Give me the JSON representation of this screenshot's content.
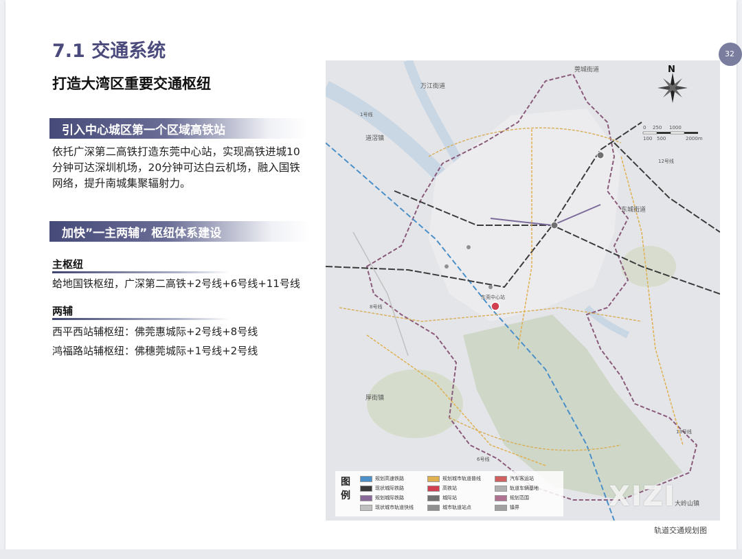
{
  "section_title": "7.1 交通系统",
  "subtitle": "打造大湾区重要交通枢纽",
  "band1": "引入中心城区第一个区域高铁站",
  "paragraph": "依托广深第二高铁打造东莞中心站，实现高铁进城10分钟可达深圳机场，20分钟可达白云机场，融入国铁网络，提升南城集聚辐射力。",
  "band2": "加快”一主两辅” 枢纽体系建设",
  "main_hub": {
    "heading": "主枢纽",
    "text": "蛤地国铁枢纽，广深第二高铁+2号线+6号线+11号线"
  },
  "aux_hubs": {
    "heading": "两辅",
    "items": [
      "西平西站辅枢纽：佛莞惠城际+2号线+8号线",
      "鸿福路站辅枢纽：佛穗莞城际+1号线+2号线"
    ]
  },
  "page_number": "32",
  "map": {
    "caption": "轨道交通规划图",
    "place_labels": [
      "莞城街道",
      "万江街道",
      "道滘镇",
      "东城街道",
      "厚街镇",
      "大岭山镇",
      "东莞中心站"
    ],
    "line_labels": [
      "1号线",
      "12号线",
      "6号线",
      "8号线",
      "13号线"
    ],
    "scale_labels": [
      "0",
      "250",
      "1000",
      "100",
      "500",
      "2000m"
    ],
    "north": "N",
    "legend_title": "图例",
    "legend": [
      {
        "label": "规划高速铁路",
        "color": "#4a8fc8"
      },
      {
        "label": "现状城际铁路",
        "color": "#3a3a3a"
      },
      {
        "label": "规划城际铁路",
        "color": "#8a6a9a"
      },
      {
        "label": "现状城市轨道快线",
        "color": "#c0c0c0"
      },
      {
        "label": "规划城市轨道普线",
        "color": "#e0b050"
      },
      {
        "label": "高铁站",
        "color": "#d04050"
      },
      {
        "label": "城际站",
        "color": "#707070"
      },
      {
        "label": "城市轨道站点",
        "color": "#909090"
      },
      {
        "label": "汽车客运站",
        "color": "#d06060"
      },
      {
        "label": "轨道车辆基地",
        "color": "#b0b0b0"
      },
      {
        "label": "规划范围",
        "color": "#b07090"
      },
      {
        "label": "镇界",
        "color": "#a0a0a0"
      }
    ]
  },
  "watermark": "XIZI",
  "colors": {
    "accent": "#4b4a7c",
    "band": "#454a78",
    "railway": "#4a8fc8",
    "boundary": "#8a5a7a"
  }
}
